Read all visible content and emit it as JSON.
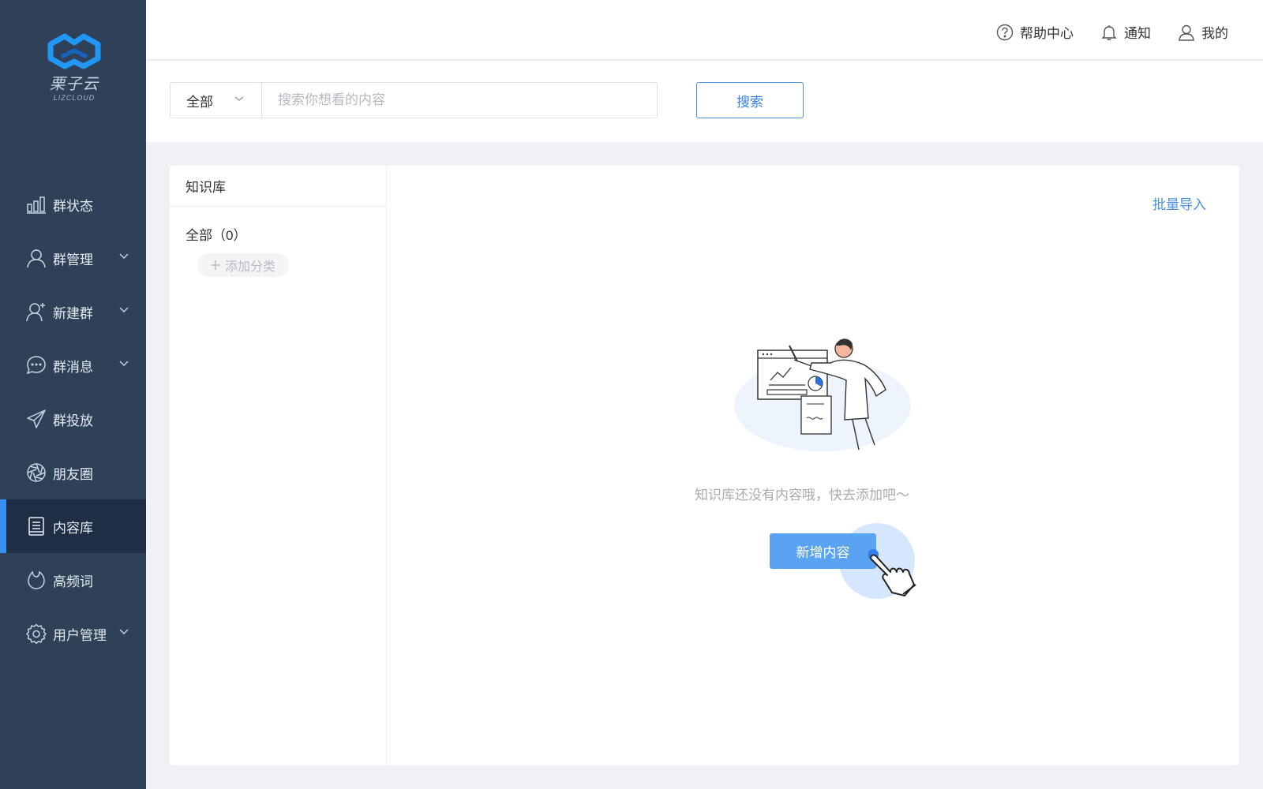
{
  "brand": {
    "name_cn": "栗子云",
    "name_en": "LIZCLOUD",
    "accent": "#3a8ef0"
  },
  "topbar": {
    "help_label": "帮助中心",
    "notify_label": "通知",
    "mine_label": "我的"
  },
  "sidebar": {
    "items": [
      {
        "label": "群状态",
        "icon": "bar-chart-icon"
      },
      {
        "label": "群管理",
        "icon": "user-icon"
      },
      {
        "label": "新建群",
        "icon": "add-user-icon"
      },
      {
        "label": "群消息",
        "icon": "chat-bubble-icon"
      },
      {
        "label": "群投放",
        "icon": "paper-plane-icon"
      },
      {
        "label": "朋友圈",
        "icon": "aperture-icon"
      },
      {
        "label": "内容库",
        "icon": "document-icon",
        "active": true
      },
      {
        "label": "高频词",
        "icon": "fire-icon"
      },
      {
        "label": "用户管理",
        "icon": "gear-icon"
      }
    ]
  },
  "search": {
    "select_value": "全部",
    "placeholder": "搜索你想看的内容",
    "button_label": "搜索"
  },
  "knowledge": {
    "title": "知识库",
    "all_label": "全部（0）",
    "add_category_label": "添加分类"
  },
  "main": {
    "batch_import_label": "批量导入",
    "empty_text": "知识库还没有内容哦，快去添加吧～",
    "add_button_label": "新增内容"
  }
}
